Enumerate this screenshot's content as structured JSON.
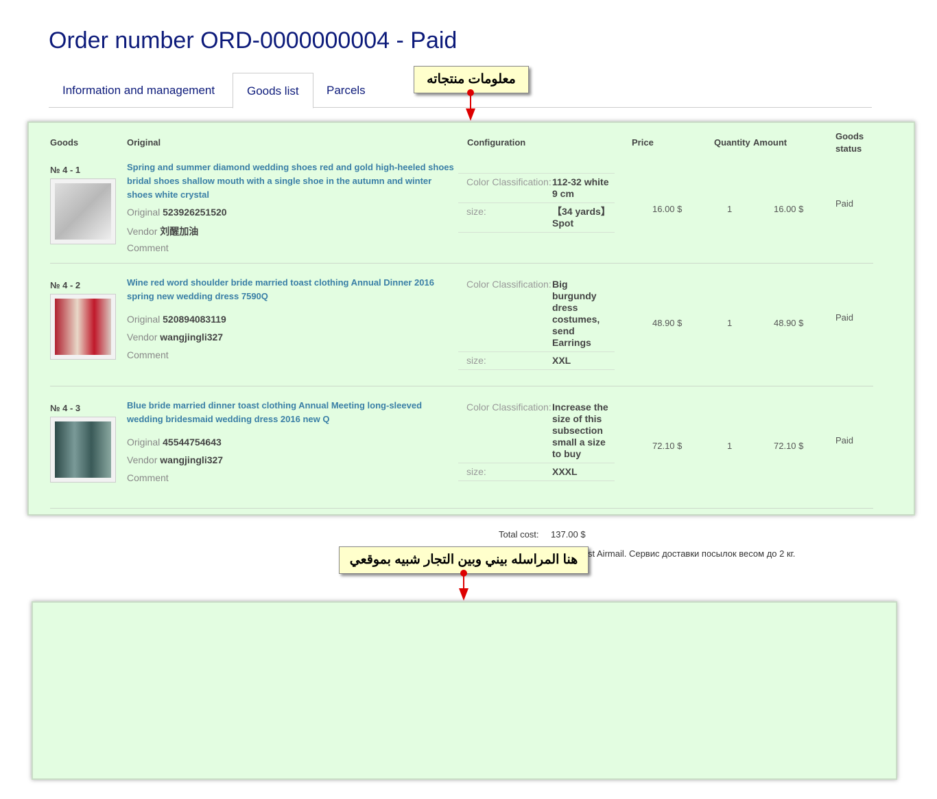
{
  "title": "Order number ORD-0000000004 - Paid",
  "tabs": [
    "Information and management",
    "Goods list",
    "Parcels"
  ],
  "headers": {
    "goods": "Goods",
    "original": "Original",
    "configuration": "Configuration",
    "price": "Price",
    "quantity": "Quantity",
    "amount": "Amount",
    "status": "Goods status"
  },
  "labels": {
    "original": "Original",
    "vendor": "Vendor",
    "comment": "Comment"
  },
  "items": [
    {
      "num": "№ 4 - 1",
      "title": "Spring and summer diamond wedding shoes red and gold high-heeled shoes bridal shoes shallow mouth with a single shoe in the autumn and winter shoes white crystal",
      "original": "523926251520",
      "vendor": "刘醒加油",
      "config": [
        {
          "label": "Color Classification:",
          "value": "112-32 white 9 cm"
        },
        {
          "label": "size:",
          "value": "【34 yards】Spot"
        }
      ],
      "price": "16.00 $",
      "qty": "1",
      "amount": "16.00 $",
      "status": "Paid"
    },
    {
      "num": "№ 4 - 2",
      "title": "Wine red word shoulder bride married toast clothing Annual Dinner 2016 spring new wedding dress 7590Q",
      "original": "520894083119",
      "vendor": "wangjingli327",
      "config": [
        {
          "label": "Color Classification:",
          "value": "Big burgundy dress costumes, send Earrings"
        },
        {
          "label": "size:",
          "value": "XXL"
        }
      ],
      "price": "48.90 $",
      "qty": "1",
      "amount": "48.90 $",
      "status": "Paid"
    },
    {
      "num": "№ 4 - 3",
      "title": "Blue bride married dinner toast clothing Annual Meeting long-sleeved wedding bridesmaid wedding dress 2016 new Q",
      "original": "45544754643",
      "vendor": "wangjingli327",
      "config": [
        {
          "label": "Color Classification:",
          "value": "Increase the size of this subsection small a size to buy"
        },
        {
          "label": "size:",
          "value": "XXXL"
        }
      ],
      "price": "72.10 $",
      "qty": "1",
      "amount": "72.10 $",
      "status": "Paid"
    }
  ],
  "total": {
    "label": "Total cost:",
    "value": "137.00 $"
  },
  "shipping": "st Airmail. Сервис доставки посылок весом до 2 кг.",
  "callouts": [
    "معلومات منتجاته",
    "هنا المراسله بيني وبين التجار شبيه بموقعي"
  ]
}
